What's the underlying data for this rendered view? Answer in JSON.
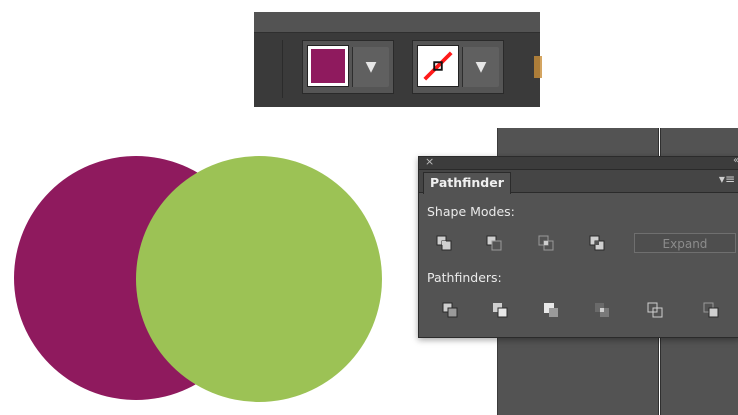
{
  "toolbar": {
    "fill_color": "#8f1a5e",
    "stroke_color": "none",
    "fill_dropdown_icon": "chevron-down-icon",
    "stroke_dropdown_icon": "chevron-down-icon"
  },
  "artwork": {
    "purple_circle_color": "#8f1a5e",
    "green_circle_color": "#9cc255"
  },
  "pathfinder_panel": {
    "tab_label": "Pathfinder",
    "close_glyph": "×",
    "collapse_glyph": "‹‹",
    "menu_glyph": "▾≡",
    "shape_modes_label": "Shape Modes:",
    "shape_modes": [
      "unite-icon",
      "minus-front-icon",
      "intersect-icon",
      "exclude-icon"
    ],
    "expand_label": "Expand",
    "pathfinders_label": "Pathfinders:",
    "pathfinders": [
      "divide-icon",
      "trim-icon",
      "merge-icon",
      "crop-icon",
      "outline-icon",
      "minus-back-icon"
    ]
  }
}
